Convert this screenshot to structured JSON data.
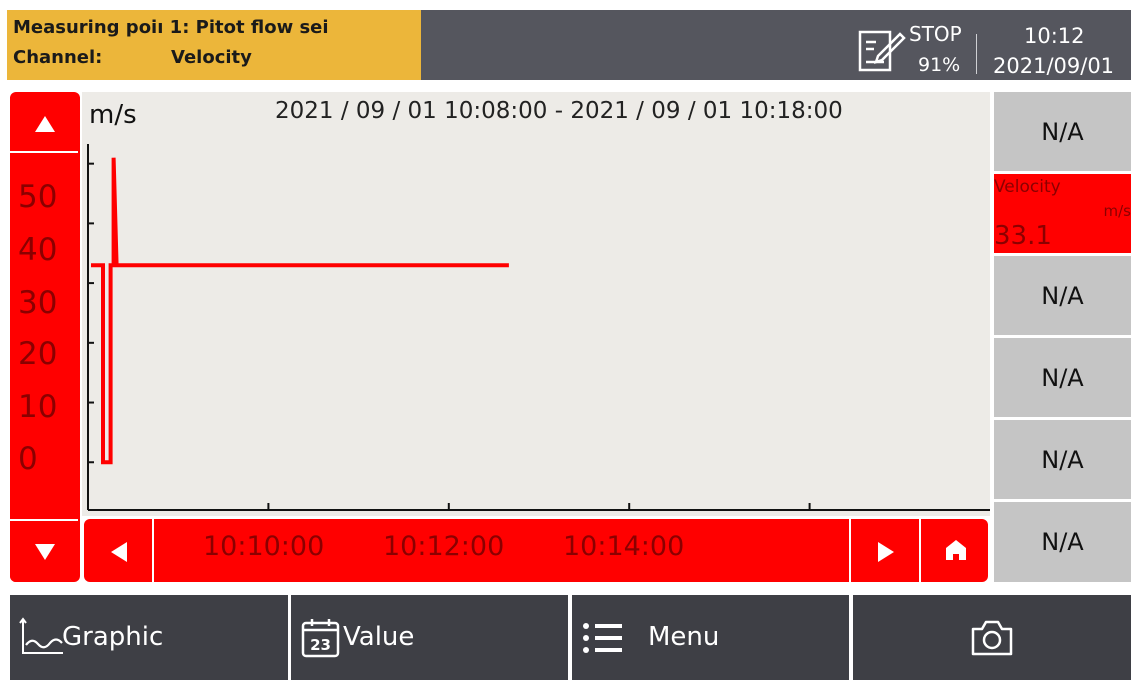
{
  "header": {
    "measuring_point": "Measuring poiı 1: Pitot flow sei",
    "channel_label": "Channel:",
    "channel_value": "Velocity",
    "status": "STOP",
    "memory": "91%",
    "time": "10:12",
    "date": "2021/09/01"
  },
  "chart": {
    "unit": "m/s",
    "range": "2021 / 09 / 01 10:08:00 - 2021 / 09 / 01 10:18:00"
  },
  "chart_data": {
    "type": "line",
    "title": "2021 / 09 / 01 10:08:00 - 2021 / 09 / 01 10:18:00",
    "ylabel": "m/s",
    "xlabel": "",
    "ylim": [
      -9,
      62
    ],
    "y_ticks": [
      "50",
      "40",
      "30",
      "20",
      "10",
      "0"
    ],
    "x_ticks": [
      "10:10:00",
      "10:12:00",
      "10:14:00"
    ],
    "series": [
      {
        "color": "#ff0000",
        "x": [
          "10:08:02",
          "10:08:10",
          "10:08:10",
          "10:08:15",
          "10:08:15",
          "10:08:17",
          "10:08:17",
          "10:08:19",
          "10:12:40"
        ],
        "y": [
          33.0,
          33.0,
          0.0,
          0.0,
          33.0,
          33.0,
          51.0,
          33.0,
          33.0
        ]
      }
    ]
  },
  "time_axis": {
    "labels": [
      "10:10:00",
      "10:12:00",
      "10:14:00"
    ]
  },
  "right_panel": {
    "slot1": "N/A",
    "active_name": "Velocity",
    "active_unit": "m/s",
    "active_value": "33.1",
    "slot3": "N/A",
    "slot4": "N/A",
    "slot5": "N/A",
    "slot6": "N/A"
  },
  "toolbar": {
    "graphic": "Graphic",
    "value": "Value",
    "value_icon_text": "23",
    "menu": "Menu"
  },
  "icons": [
    "record-icon",
    "arrow-up-icon",
    "arrow-down-icon",
    "arrow-left-icon",
    "arrow-right-icon",
    "home-icon",
    "graphic-icon",
    "calendar-icon",
    "menu-icon",
    "camera-icon"
  ],
  "colors": {
    "accent": "#ff0000",
    "header": "#ecb63a",
    "bar": "#55565e",
    "toolbar": "#3e3f45"
  }
}
